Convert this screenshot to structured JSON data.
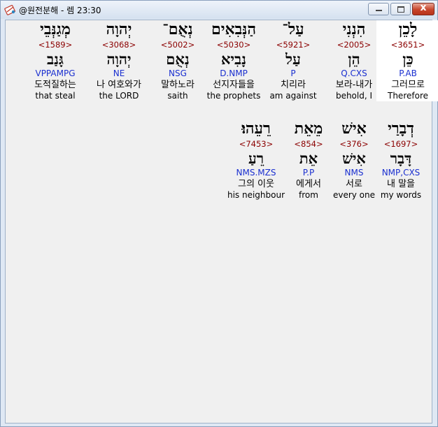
{
  "window": {
    "title": "@원전분해 - 렘 23:30",
    "close_label": "x"
  },
  "words": [
    {
      "hebrew": "לָכֵן",
      "strong": "<3651>",
      "lemma": "כֵּן",
      "morph": "P.AB",
      "korean": "그러므로",
      "english": "Therefore",
      "selected": true
    },
    {
      "hebrew": "הִנְנִי",
      "strong": "<2005>",
      "lemma": "הֵן",
      "morph": "Q.CXS",
      "korean": "보라-내가",
      "english": "behold, I"
    },
    {
      "hebrew": "עַל־",
      "strong": "<5921>",
      "lemma": "עַל",
      "morph": "P",
      "korean": "치리라",
      "english": "am against"
    },
    {
      "hebrew": "הַנְּבִאִים",
      "strong": "<5030>",
      "lemma": "נָבִיא",
      "morph": "D.NMP",
      "korean": "선지자들을",
      "english": "the prophets"
    },
    {
      "hebrew": "נְאֻם־",
      "strong": "<5002>",
      "lemma": "נְאֻם",
      "morph": "NSG",
      "korean": "말하노라",
      "english": "saith"
    },
    {
      "hebrew": "יְהוָה",
      "strong": "<3068>",
      "lemma": "יְהוָה",
      "morph": "NE",
      "korean": "나 여호와가",
      "english": "the LORD"
    },
    {
      "hebrew": "מְגַנְּבֵי",
      "strong": "<1589>",
      "lemma": "גָּנַב",
      "morph": "VPPAMPG",
      "korean": "도적질하는",
      "english": "that steal"
    },
    {
      "hebrew": "דְבָרַי",
      "strong": "<1697>",
      "lemma": "דָּבָר",
      "morph": "NMP,CXS",
      "korean": "내 말을",
      "english": "my words"
    },
    {
      "hebrew": "אִישׁ",
      "strong": "<376>",
      "lemma": "אִישׁ",
      "morph": "NMS",
      "korean": "서로",
      "english": "every one"
    },
    {
      "hebrew": "מֵאֵת",
      "strong": "<854>",
      "lemma": "אֵת",
      "morph": "P.P",
      "korean": "에게서",
      "english": "from"
    },
    {
      "hebrew": "רֵעֵהוּ׃",
      "strong": "<7453>",
      "lemma": "רֵעַ",
      "morph": "NMS.MZS",
      "korean": "그의 이웃",
      "english": "his neighbour"
    }
  ]
}
